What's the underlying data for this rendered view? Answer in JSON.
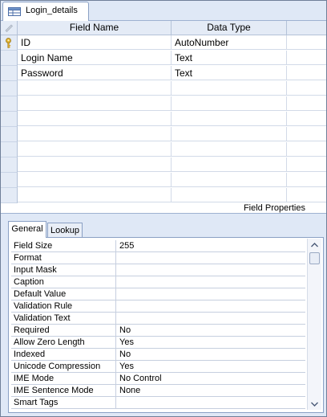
{
  "window": {
    "tab_label": "Login_details"
  },
  "design_grid": {
    "columns": [
      "Field Name",
      "Data Type"
    ],
    "rows": [
      {
        "field_name": "ID",
        "data_type": "AutoNumber",
        "primary_key": true
      },
      {
        "field_name": "Login Name",
        "data_type": "Text",
        "primary_key": false
      },
      {
        "field_name": "Password",
        "data_type": "Text",
        "primary_key": false
      }
    ]
  },
  "field_properties": {
    "title": "Field Properties",
    "tabs": [
      "General",
      "Lookup"
    ],
    "active_tab": "General",
    "properties": [
      {
        "name": "Field Size",
        "value": "255"
      },
      {
        "name": "Format",
        "value": ""
      },
      {
        "name": "Input Mask",
        "value": ""
      },
      {
        "name": "Caption",
        "value": ""
      },
      {
        "name": "Default Value",
        "value": ""
      },
      {
        "name": "Validation Rule",
        "value": ""
      },
      {
        "name": "Validation Text",
        "value": ""
      },
      {
        "name": "Required",
        "value": "No"
      },
      {
        "name": "Allow Zero Length",
        "value": "Yes"
      },
      {
        "name": "Indexed",
        "value": "No"
      },
      {
        "name": "Unicode Compression",
        "value": "Yes"
      },
      {
        "name": "IME Mode",
        "value": "No Control"
      },
      {
        "name": "IME Sentence Mode",
        "value": "None"
      },
      {
        "name": "Smart Tags",
        "value": ""
      }
    ]
  },
  "icons": {
    "tab": "table-icon",
    "key": "primary-key-icon",
    "corner": "pencil-icon",
    "scroll_up": "chevron-up-icon",
    "scroll_down": "chevron-down-icon"
  },
  "colors": {
    "chrome": "#dfe8f6",
    "border": "#8aa0c4",
    "header": "#e4ebf6",
    "key": "#d8a72a"
  }
}
